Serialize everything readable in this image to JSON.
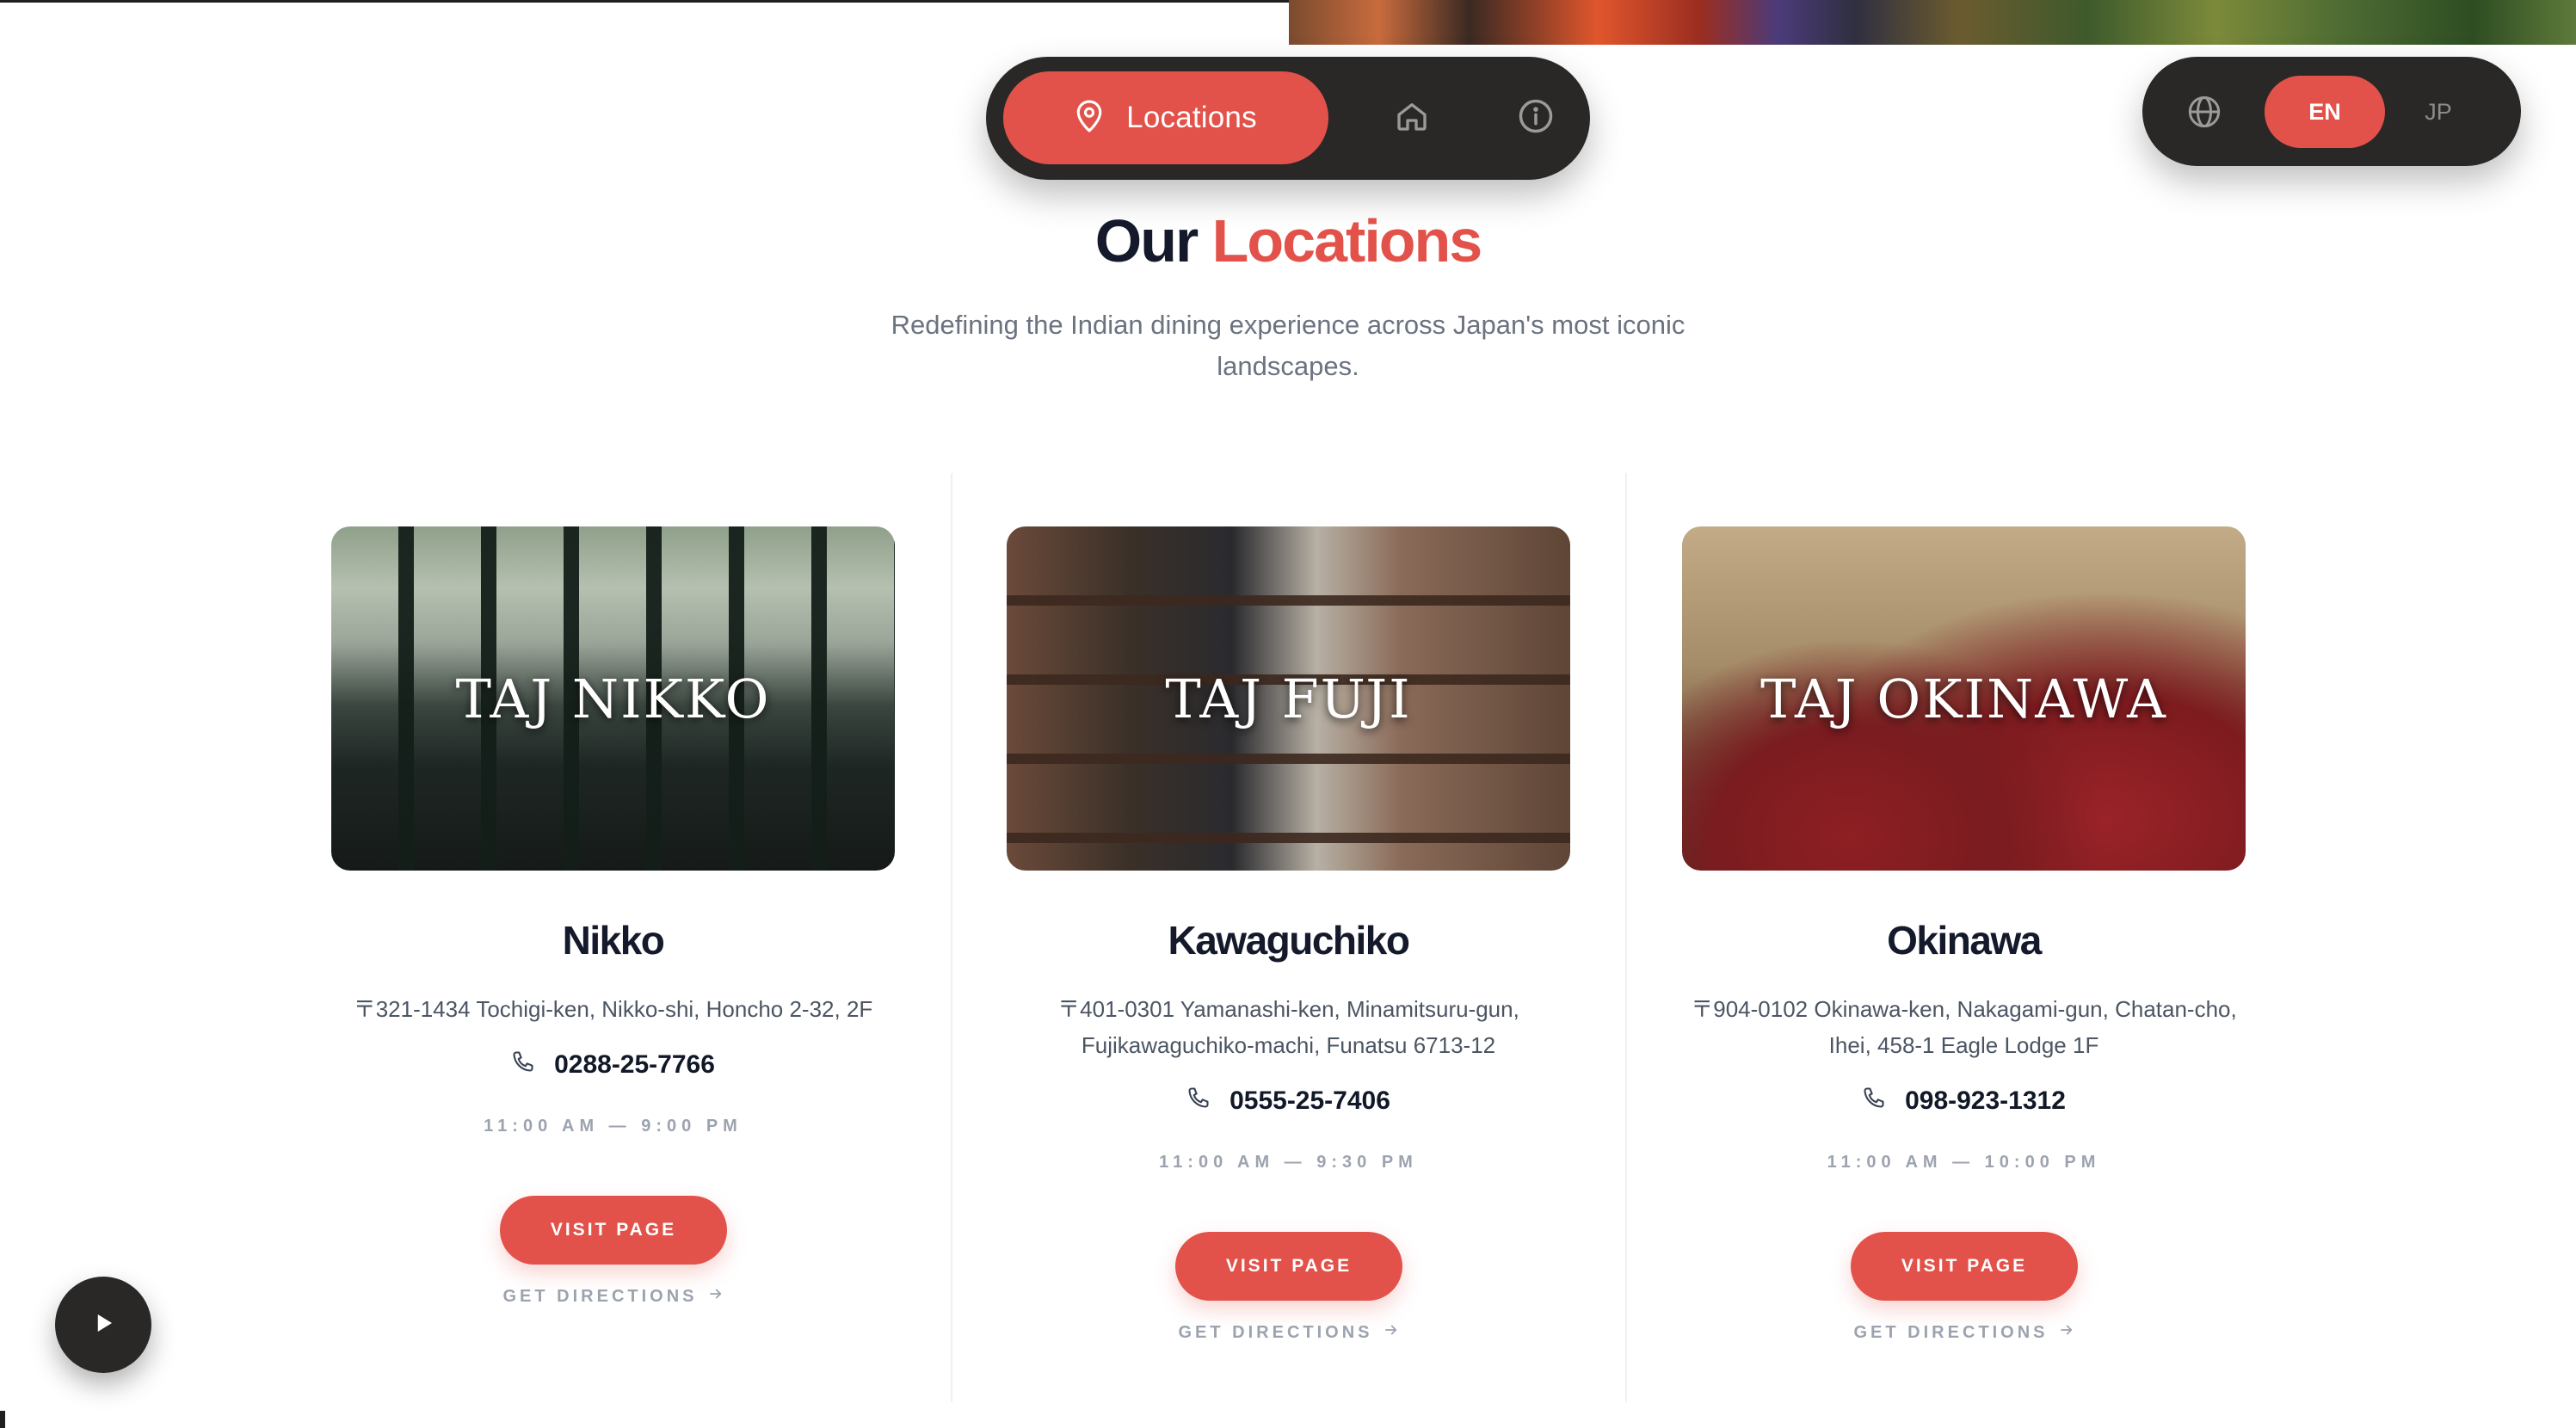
{
  "nav": {
    "active_label": "Locations",
    "icons": [
      "map-pin-icon",
      "home-icon",
      "info-icon"
    ]
  },
  "language": {
    "options": [
      "EN",
      "JP"
    ],
    "selected": "EN"
  },
  "header": {
    "title_part1": "Our",
    "title_part2": "Locations",
    "subtitle": "Redefining the Indian dining experience across Japan's most iconic landscapes."
  },
  "locations": [
    {
      "photo_title": "TAJ NIKKO",
      "name": "Nikko",
      "address": "〒321-1434 Tochigi-ken, Nikko-shi, Honcho 2-32, 2F",
      "phone": "0288-25-7766",
      "hours": "11:00 AM — 9:00 PM",
      "visit_label": "VISIT PAGE",
      "directions_label": "GET DIRECTIONS"
    },
    {
      "photo_title": "TAJ FUJI",
      "name": "Kawaguchiko",
      "address": "〒401-0301 Yamanashi-ken, Minamitsuru-gun, Fujikawaguchiko-machi, Funatsu 6713-12",
      "phone": "0555-25-7406",
      "hours": "11:00 AM — 9:30 PM",
      "visit_label": "VISIT PAGE",
      "directions_label": "GET DIRECTIONS"
    },
    {
      "photo_title": "TAJ OKINAWA",
      "name": "Okinawa",
      "address": "〒904-0102 Okinawa-ken, Nakagami-gun, Chatan-cho, Ihei, 458-1 Eagle Lodge 1F",
      "phone": "098-923-1312",
      "hours": "11:00 AM — 10:00 PM",
      "visit_label": "VISIT PAGE",
      "directions_label": "GET DIRECTIONS"
    }
  ],
  "player": {
    "icon": "play-icon"
  },
  "colors": {
    "accent": "#e2524a",
    "dark": "#2a2826",
    "heading": "#141a2b",
    "muted": "#9ca3af"
  }
}
